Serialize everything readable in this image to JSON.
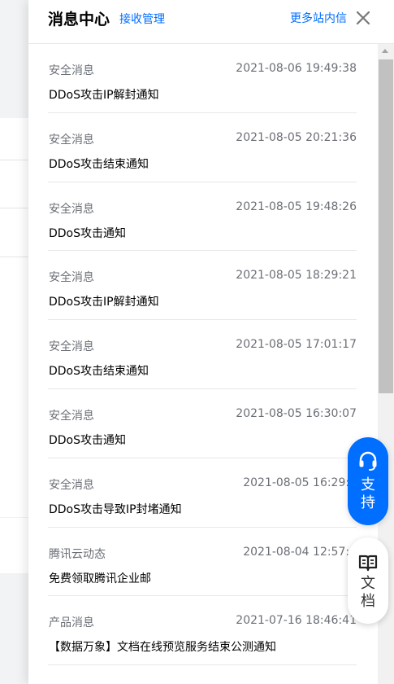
{
  "header": {
    "title": "消息中心",
    "manage_label": "接收管理",
    "more_label": "更多站内信",
    "close_icon": "close-icon"
  },
  "messages": [
    {
      "category": "安全消息",
      "time": "2021-08-06 19:49:38",
      "title": "DDoS攻击IP解封通知"
    },
    {
      "category": "安全消息",
      "time": "2021-08-05 20:21:36",
      "title": "DDoS攻击结束通知"
    },
    {
      "category": "安全消息",
      "time": "2021-08-05 19:48:26",
      "title": "DDoS攻击通知"
    },
    {
      "category": "安全消息",
      "time": "2021-08-05 18:29:21",
      "title": "DDoS攻击IP解封通知"
    },
    {
      "category": "安全消息",
      "time": "2021-08-05 17:01:17",
      "title": "DDoS攻击结束通知"
    },
    {
      "category": "安全消息",
      "time": "2021-08-05 16:30:07",
      "title": "DDoS攻击通知"
    },
    {
      "category": "安全消息",
      "time": "2021-08-05 16:29:1",
      "title": "DDoS攻击导致IP封堵通知"
    },
    {
      "category": "腾讯云动态",
      "time": "2021-08-04 12:57:1",
      "title": "免费领取腾讯企业邮"
    },
    {
      "category": "产品消息",
      "time": "2021-07-16 18:46:41",
      "title": "【数据万象】文档在线预览服务结束公测通知"
    }
  ],
  "float_buttons": {
    "support_label": "支持",
    "support_icon": "headset-icon",
    "docs_label": "文档",
    "docs_icon": "book-icon"
  },
  "colors": {
    "accent": "#006eff",
    "muted_text": "#6b6f76",
    "divider": "#e6e8eb"
  }
}
